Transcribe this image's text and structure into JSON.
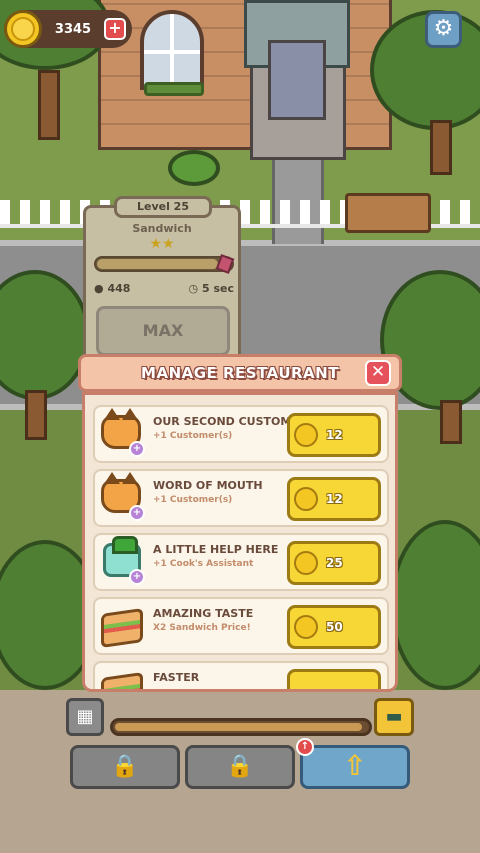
{
  "hud": {
    "coins": "3345",
    "plus_label": "+",
    "settings_icon": "gear-icon"
  },
  "station": {
    "level": "Level 25",
    "name": "Sandwich",
    "stars": "★★",
    "progress": 0.92,
    "income": "448",
    "time": "5 sec",
    "max_label": "MAX"
  },
  "modal": {
    "title": "MANAGE RESTAURANT",
    "close_label": "✕",
    "items": [
      {
        "title": "OUR SECOND CUSTOMER!",
        "subtitle": "+1 Customer(s)",
        "cost": "12",
        "icon": "cat-customer-icon"
      },
      {
        "title": "WORD OF MOUTH",
        "subtitle": "+1 Customer(s)",
        "cost": "12",
        "icon": "cat-customer-icon"
      },
      {
        "title": "A LITTLE HELP HERE",
        "subtitle": "+1 Cook's Assistant",
        "cost": "25",
        "icon": "robot-assistant-icon"
      },
      {
        "title": "AMAZING TASTE",
        "subtitle": "X2 Sandwich Price!",
        "cost": "50",
        "icon": "sandwich-icon"
      },
      {
        "title": "FASTER",
        "subtitle": "",
        "cost": "",
        "icon": "sandwich-icon"
      }
    ]
  },
  "bottom": {
    "exp_progress": 0.98,
    "lock_icon": "🔒",
    "upgrade_icon": "⇧",
    "alert_icon": "↑"
  },
  "colors": {
    "accent_yellow": "#f7d736",
    "modal_header": "#f4c4a9",
    "close_red": "#e6525c",
    "blue_button": "#6fa6c9"
  }
}
